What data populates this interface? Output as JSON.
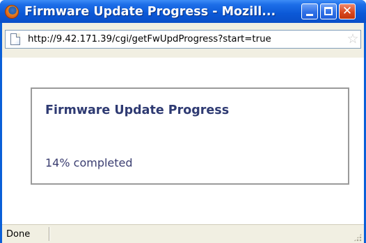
{
  "window": {
    "title": "Firmware Update Progress - Mozill...",
    "controls": {
      "minimize_icon": "minimize-icon",
      "maximize_icon": "maximize-icon",
      "close_icon": "close-icon"
    }
  },
  "address_bar": {
    "url": "http://9.42.171.39/cgi/getFwUpdProgress?start=true",
    "page_icon": "page-icon",
    "bookmark_icon": "star-icon"
  },
  "panel": {
    "title": "Firmware Update Progress",
    "status": "14% completed",
    "progress_percent": 14
  },
  "statusbar": {
    "text": "Done"
  },
  "colors": {
    "titlebar": "#0b58d6",
    "panel_title": "#2e3a72",
    "panel_border": "#9a9a9a",
    "close_button": "#d9481f"
  }
}
